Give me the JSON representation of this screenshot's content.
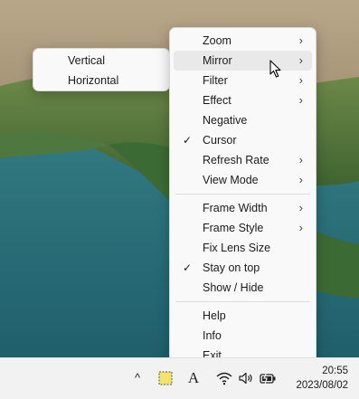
{
  "main_menu": {
    "items": [
      {
        "label": "Zoom",
        "checked": false,
        "submenu": true
      },
      {
        "label": "Mirror",
        "checked": false,
        "submenu": true,
        "hover": true
      },
      {
        "label": "Filter",
        "checked": false,
        "submenu": true
      },
      {
        "label": "Effect",
        "checked": false,
        "submenu": true
      },
      {
        "label": "Negative",
        "checked": false,
        "submenu": false
      },
      {
        "label": "Cursor",
        "checked": true,
        "submenu": false
      },
      {
        "label": "Refresh Rate",
        "checked": false,
        "submenu": true
      },
      {
        "label": "View Mode",
        "checked": false,
        "submenu": true
      },
      {
        "label": "Frame Width",
        "checked": false,
        "submenu": true
      },
      {
        "label": "Frame Style",
        "checked": false,
        "submenu": true
      },
      {
        "label": "Fix Lens Size",
        "checked": false,
        "submenu": false
      },
      {
        "label": "Stay on top",
        "checked": true,
        "submenu": false
      },
      {
        "label": "Show / Hide",
        "checked": false,
        "submenu": false
      },
      {
        "label": "Help",
        "checked": false,
        "submenu": false
      },
      {
        "label": "Info",
        "checked": false,
        "submenu": false
      },
      {
        "label": "Exit",
        "checked": false,
        "submenu": false
      }
    ]
  },
  "sub_menu": {
    "items": [
      {
        "label": "Vertical"
      },
      {
        "label": "Horizontal"
      }
    ]
  },
  "glyphs": {
    "check": "✓",
    "chevron": "›"
  },
  "taskbar": {
    "chevron_up": "^",
    "font_icon": "A",
    "time": "20:55",
    "date": "2023/08/02"
  },
  "colors": {
    "menu_bg": "#f9f9f9",
    "hover_bg": "#e9e9e9",
    "taskbar_bg": "#f2f2f2"
  }
}
